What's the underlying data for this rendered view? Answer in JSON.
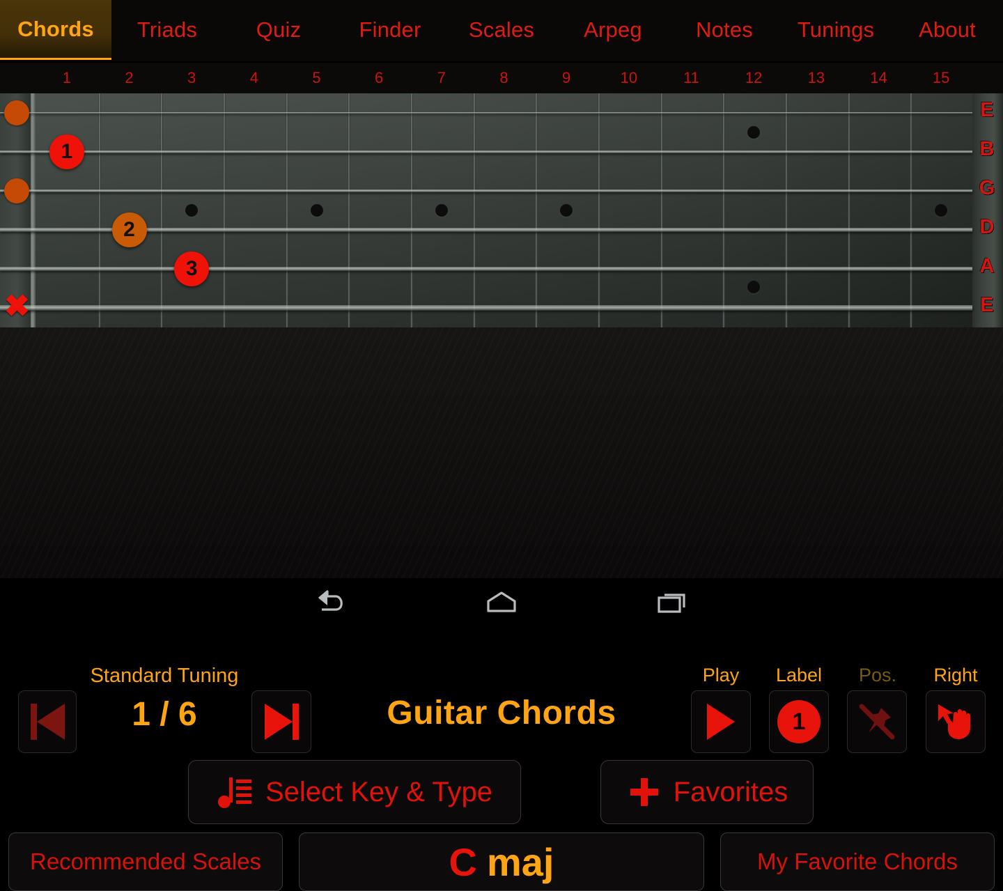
{
  "tabs": [
    {
      "id": "chords",
      "label": "Chords",
      "active": true
    },
    {
      "id": "triads",
      "label": "Triads",
      "active": false
    },
    {
      "id": "quiz",
      "label": "Quiz",
      "active": false
    },
    {
      "id": "finder",
      "label": "Finder",
      "active": false
    },
    {
      "id": "scales",
      "label": "Scales",
      "active": false
    },
    {
      "id": "arpeg",
      "label": "Arpeg",
      "active": false
    },
    {
      "id": "notes",
      "label": "Notes",
      "active": false
    },
    {
      "id": "tunings",
      "label": "Tunings",
      "active": false
    },
    {
      "id": "about",
      "label": "About",
      "active": false
    }
  ],
  "fretboard": {
    "fret_numbers": [
      "1",
      "2",
      "3",
      "4",
      "5",
      "6",
      "7",
      "8",
      "9",
      "10",
      "11",
      "12",
      "13",
      "14",
      "15"
    ],
    "string_labels": [
      "E",
      "B",
      "G",
      "D",
      "A",
      "E"
    ],
    "open_strings": [
      1,
      3
    ],
    "muted_strings": [
      6
    ],
    "finger_positions": [
      {
        "finger": "1",
        "string": 2,
        "fret": 1,
        "color": "#ee1208"
      },
      {
        "finger": "2",
        "string": 4,
        "fret": 2,
        "color": "#c95a06"
      },
      {
        "finger": "3",
        "string": 5,
        "fret": 3,
        "color": "#ee1208"
      }
    ],
    "inlay_frets": [
      3,
      5,
      7,
      9,
      12,
      15
    ]
  },
  "controls": {
    "tuning": "Standard Tuning",
    "page_counter": "1 / 6",
    "app_title": "Guitar Chords",
    "prev_label": "previous",
    "next_label": "next",
    "play_label": "Play",
    "label_label": "Label",
    "label_value": "1",
    "pos_label": "Pos.",
    "right_label": "Right"
  },
  "actions": {
    "select_key": "Select Key & Type",
    "favorites": "Favorites",
    "recommended_scales": "Recommended Scales",
    "my_favorite_chords": "My Favorite Chords"
  },
  "chord": {
    "root": "C",
    "type": "maj"
  },
  "navbar": {
    "back": "back",
    "home": "home",
    "recents": "recents"
  },
  "colors": {
    "accent_orange": "#ffa412",
    "accent_red": "#e8140b",
    "dim_red": "#7c1410",
    "tab_active_bg": "#4a3409",
    "finger_red": "#ee1208",
    "finger_orange": "#c95a06"
  }
}
